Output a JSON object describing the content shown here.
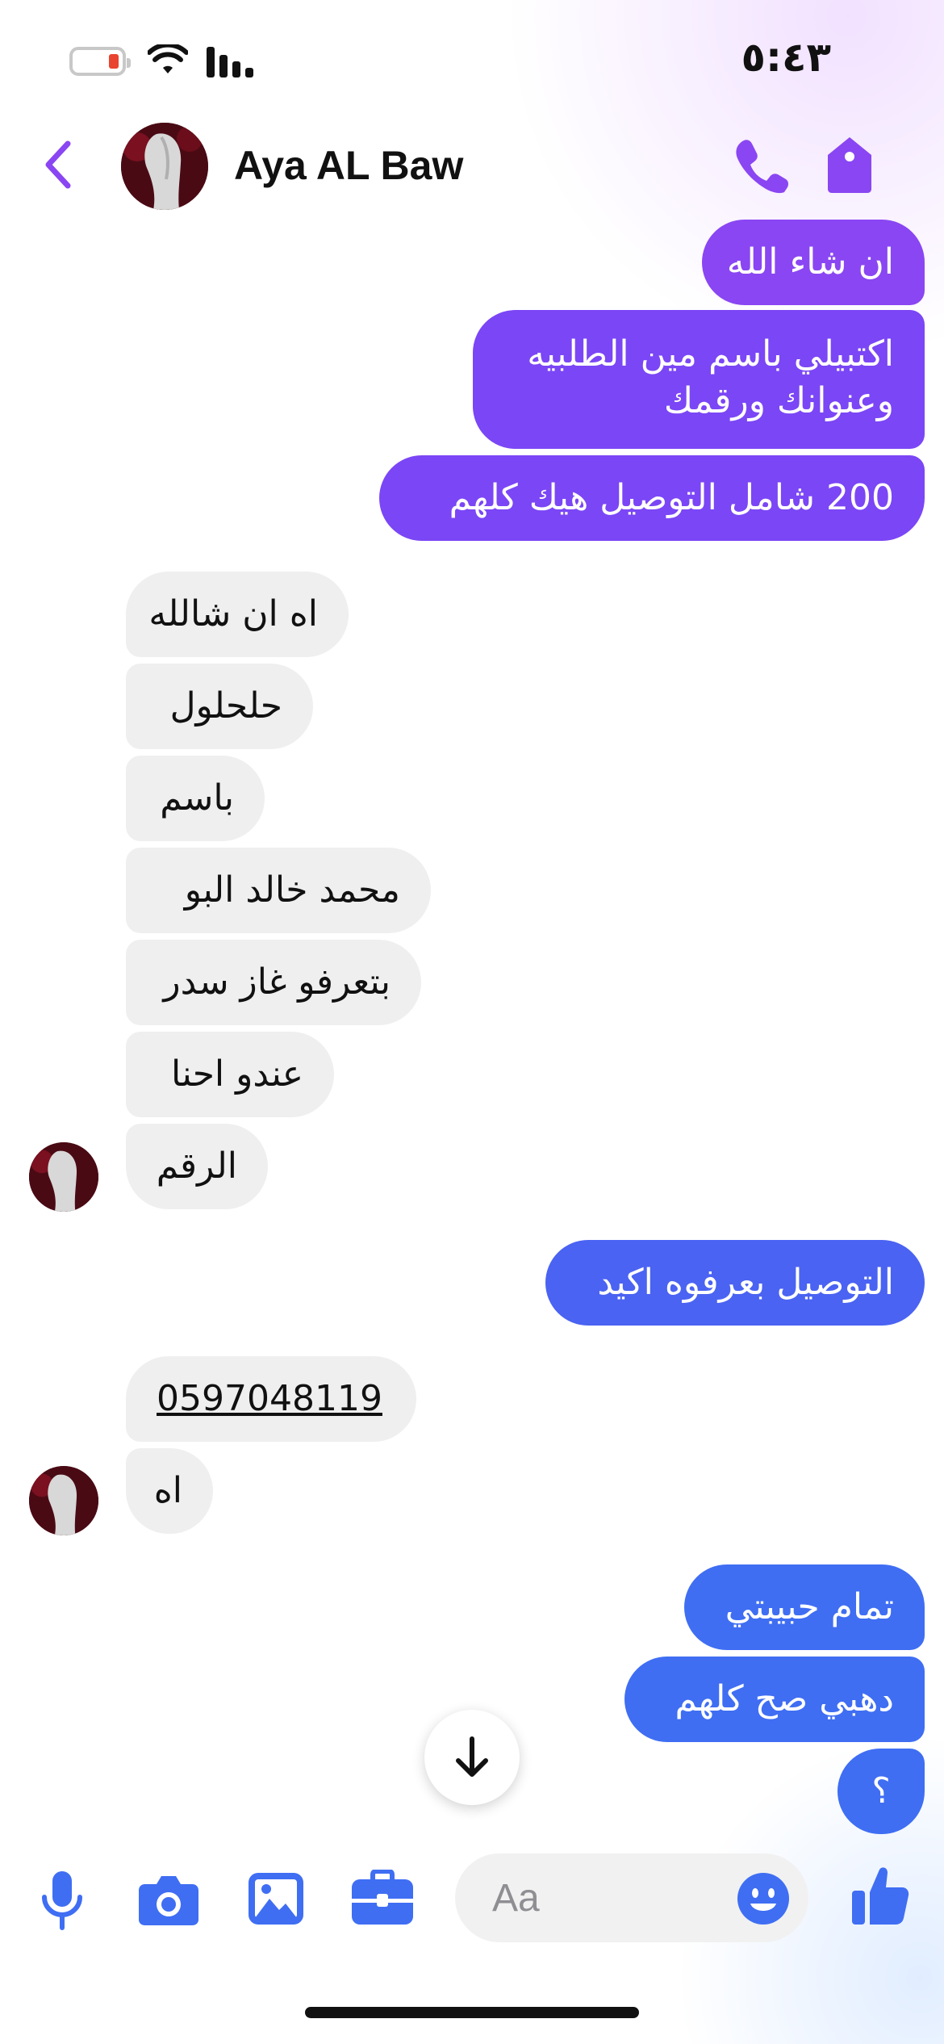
{
  "status_bar": {
    "time": "٥:٤٣",
    "battery_level": 0.1
  },
  "header": {
    "contact_name": "Aya AL Baw"
  },
  "messages": [
    {
      "direction": "out",
      "text": "ان شاء الله"
    },
    {
      "direction": "out",
      "line1": "اكتبيلي باسم مين الطلبيه",
      "line2": "وعنوانك ورقمك"
    },
    {
      "direction": "out",
      "text": "200 شامل التوصيل هيك كلهم"
    },
    {
      "direction": "in",
      "text": "اه ان شالله"
    },
    {
      "direction": "in",
      "text": "حلحلول"
    },
    {
      "direction": "in",
      "text": "باسم"
    },
    {
      "direction": "in",
      "text": "محمد خالد البو"
    },
    {
      "direction": "in",
      "text": "بتعرفو غاز سدر"
    },
    {
      "direction": "in",
      "text": "عندو احنا"
    },
    {
      "direction": "in",
      "text": "الرقم"
    },
    {
      "direction": "out",
      "text": "التوصيل بعرفوه اكيد"
    },
    {
      "direction": "in",
      "text": "0597048119"
    },
    {
      "direction": "in",
      "text": "اه"
    },
    {
      "direction": "out",
      "text": "تمام حبيبتي"
    },
    {
      "direction": "out",
      "text": "دهبي صح كلهم"
    },
    {
      "direction": "out",
      "text": "؟"
    }
  ],
  "composer": {
    "placeholder": "Aa"
  },
  "colors": {
    "accent_purple": "#8a46f2",
    "accent_blue": "#3f6ef3",
    "incoming_bubble": "#efefef"
  },
  "icons": [
    "back-icon",
    "call-icon",
    "tag-icon",
    "mic-icon",
    "camera-icon",
    "gallery-icon",
    "briefcase-icon",
    "emoji-icon",
    "like-icon",
    "arrow-down-icon"
  ]
}
